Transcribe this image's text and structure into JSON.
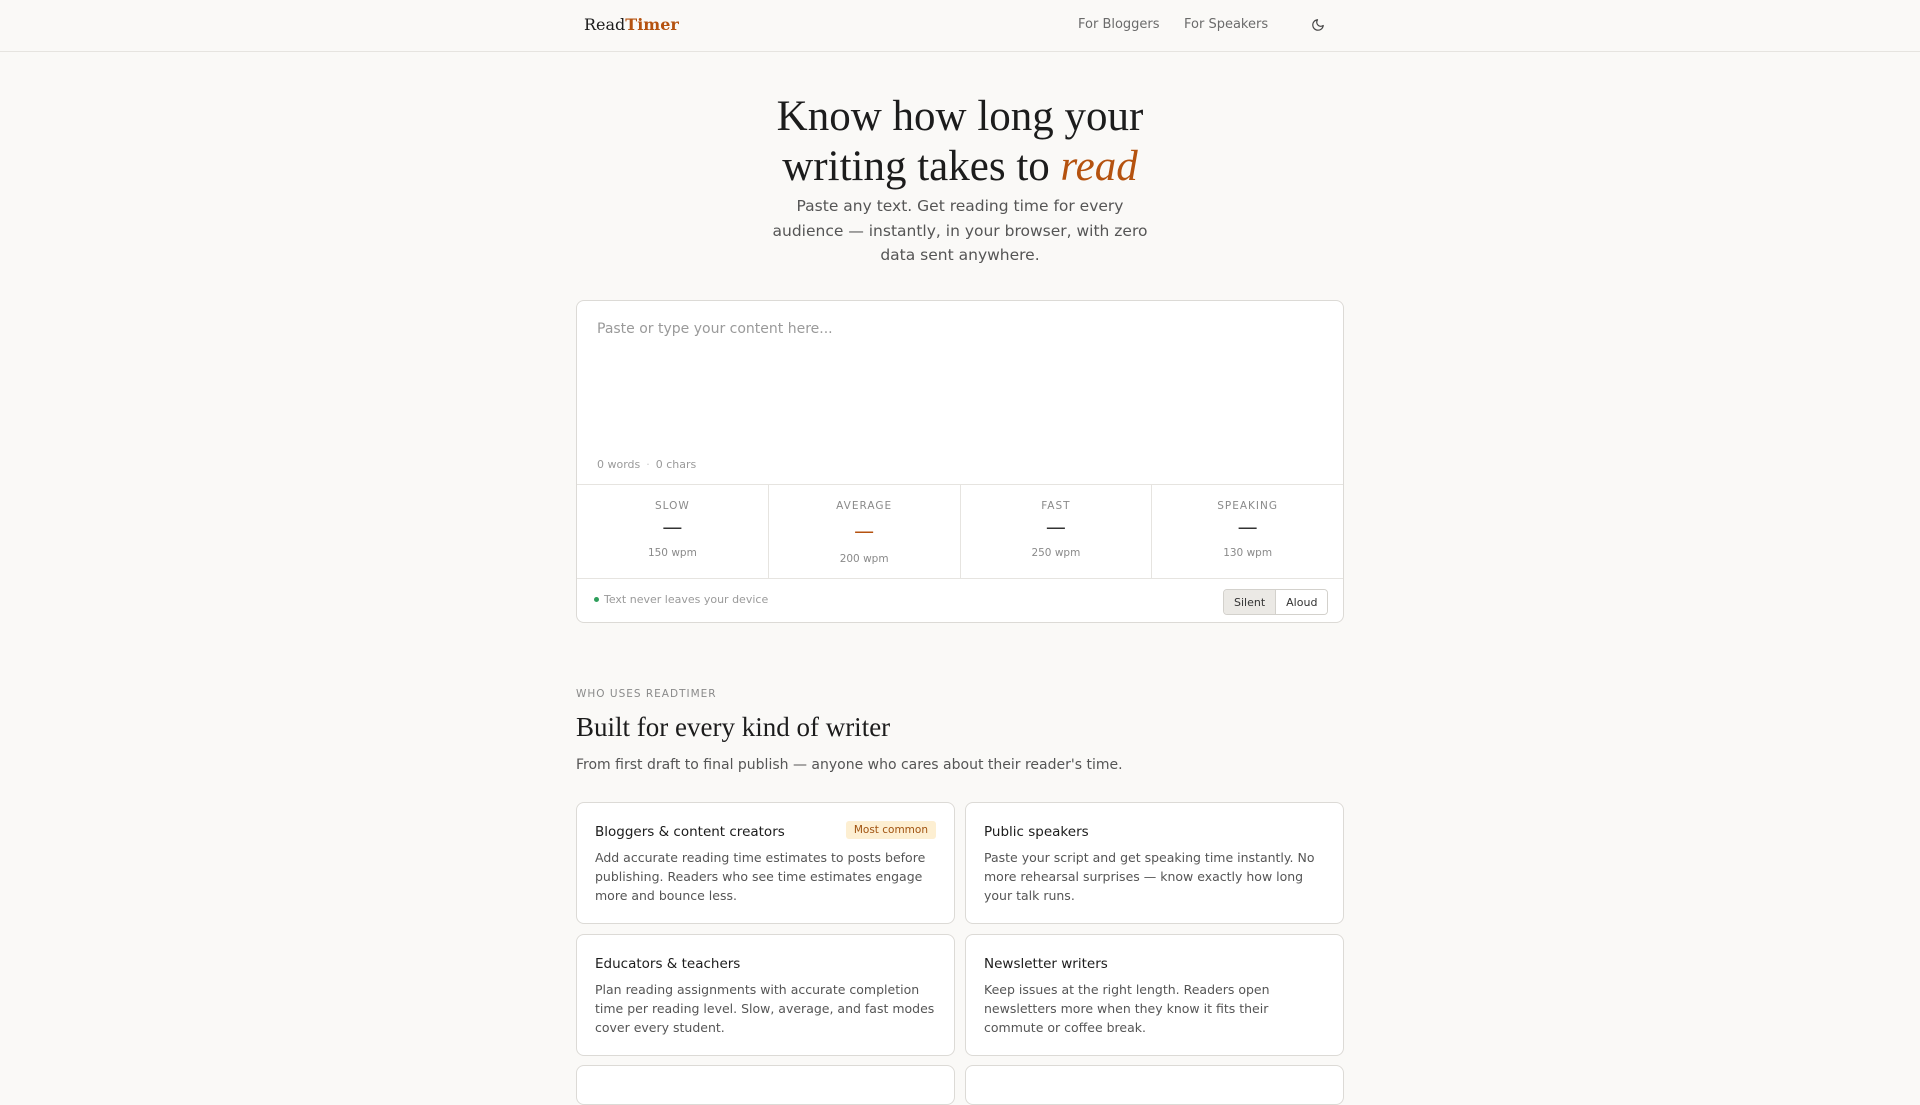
{
  "nav": {
    "brand_part1": "Read",
    "brand_part2": "Timer",
    "links": [
      "For Bloggers",
      "For Speakers"
    ],
    "theme_icon": "moon-icon"
  },
  "hero": {
    "title_line1": "Know how long your",
    "title_line2_prefix": "writing takes to ",
    "title_emphasis": "read",
    "subtitle": "Paste any text. Get reading time for every audience — instantly, in your browser, with zero data sent anywhere."
  },
  "tool": {
    "placeholder": "Paste or type your content here...",
    "text_value": "",
    "word_count": "0 words",
    "char_count": "0 chars",
    "stats": [
      {
        "label": "SLOW",
        "value": "—",
        "wpm": "150 wpm"
      },
      {
        "label": "AVERAGE",
        "value": "—",
        "wpm": "200 wpm"
      },
      {
        "label": "FAST",
        "value": "—",
        "wpm": "250 wpm"
      },
      {
        "label": "SPEAKING",
        "value": "—",
        "wpm": "130 wpm"
      }
    ],
    "privacy_note": "Text never leaves your device",
    "modes": [
      "Silent",
      "Aloud"
    ],
    "active_mode": "Silent",
    "accent_color": "#b5520f",
    "privacy_dot_color": "#2e9e5b"
  },
  "who": {
    "eyebrow": "WHO USES READTIMER",
    "title": "Built for every kind of writer",
    "subtitle": "From first draft to final publish — anyone who cares about their reader's time.",
    "cards": [
      {
        "title": "Bloggers & content creators",
        "badge": "Most common",
        "desc": "Add accurate reading time estimates to posts before publishing. Readers who see time estimates engage more and bounce less."
      },
      {
        "title": "Public speakers",
        "desc": "Paste your script and get speaking time instantly. No more rehearsal surprises — know exactly how long your talk runs."
      },
      {
        "title": "Educators & teachers",
        "desc": "Plan reading assignments with accurate completion time per reading level. Slow, average, and fast modes cover every student."
      },
      {
        "title": "Newsletter writers",
        "desc": "Keep issues at the right length. Readers open newsletters more when they know it fits their commute or coffee break."
      }
    ]
  }
}
